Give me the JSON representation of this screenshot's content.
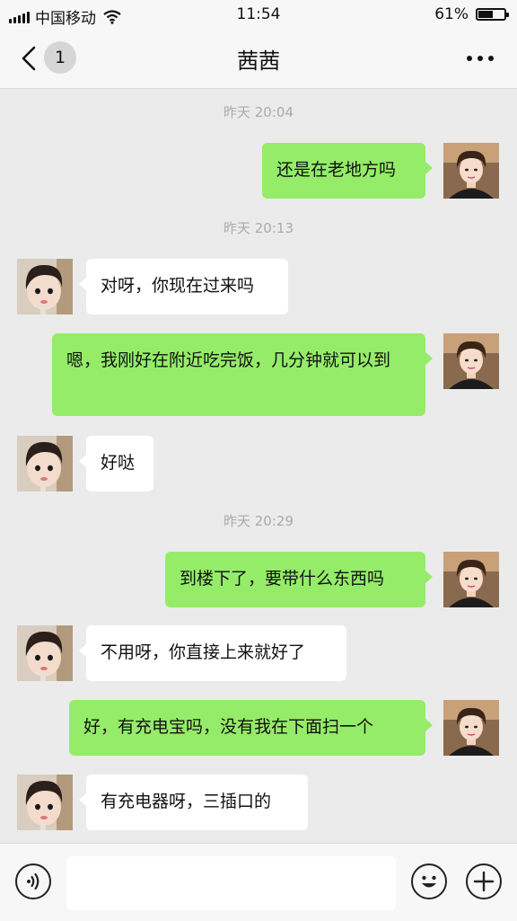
{
  "status_bar": {
    "carrier": "中国移动",
    "time": "11:54",
    "battery": "61%",
    "battery_level": 0.61
  },
  "nav": {
    "unread_count": "1",
    "title": "茜茜"
  },
  "timestamps": [
    "昨天 20:04",
    "昨天 20:13",
    "昨天 20:29"
  ],
  "messages": [
    {
      "from": "me",
      "text": "还是在老地方吗"
    },
    {
      "from": "contact",
      "text": "对呀，你现在过来吗"
    },
    {
      "from": "me",
      "text": "嗯，我刚好在附近吃完饭，几分钟就可以到"
    },
    {
      "from": "contact",
      "text": "好哒"
    },
    {
      "from": "me",
      "text": "到楼下了，要带什么东西吗"
    },
    {
      "from": "contact",
      "text": "不用呀，你直接上来就好了"
    },
    {
      "from": "me",
      "text": "好，有充电宝吗，没有我在下面扫一个"
    },
    {
      "from": "contact",
      "text": "有充电器呀，三插口的"
    }
  ],
  "icons": {
    "back": "chevron-left-icon",
    "more": "more-dots-icon",
    "voice": "voice-icon",
    "emoji": "emoji-icon",
    "add": "add-icon"
  },
  "colors": {
    "outgoing_bubble": "#95ec69",
    "incoming_bubble": "#ffffff",
    "chat_background": "#ebebeb"
  }
}
